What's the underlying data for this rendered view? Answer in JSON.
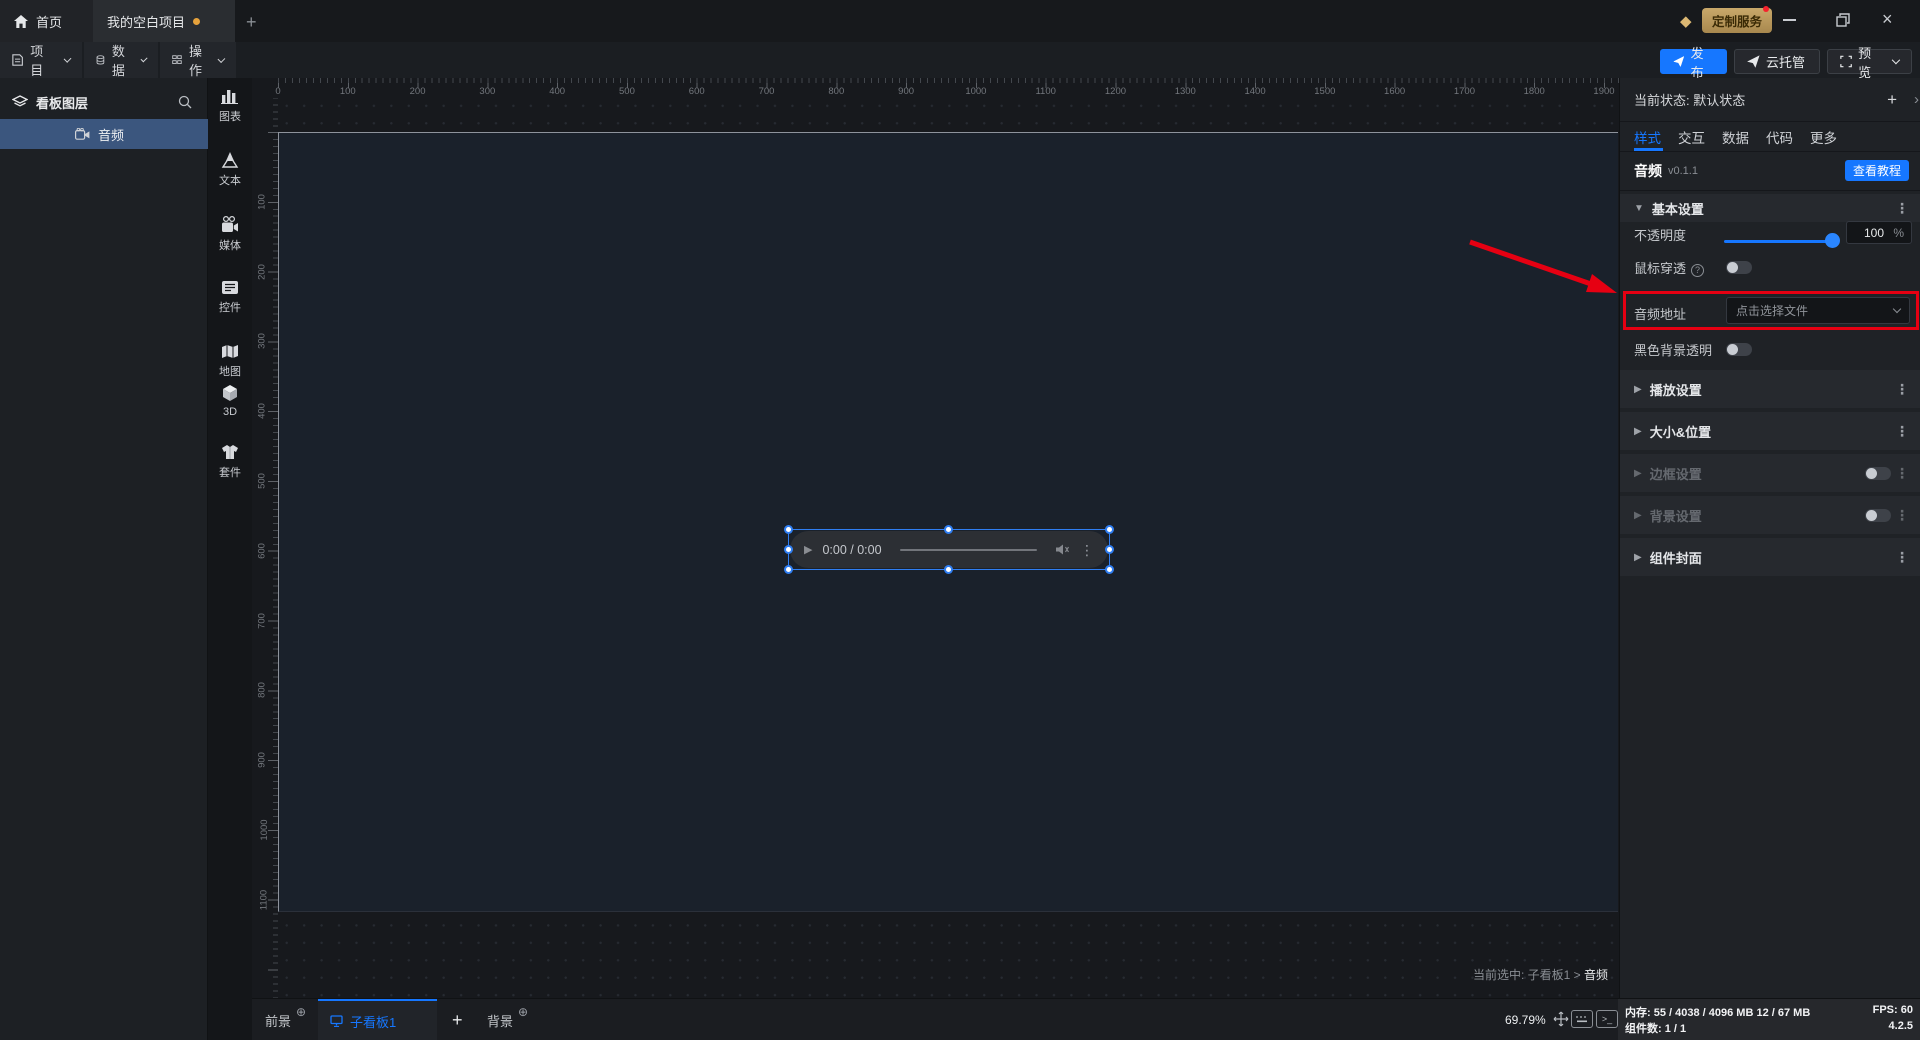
{
  "window": {
    "tabs": [
      {
        "label": "首页"
      },
      {
        "label": "我的空白项目"
      }
    ],
    "new_tab": "+",
    "vip": "定制服务",
    "close": "×"
  },
  "toolbar": {
    "menus": [
      "项目",
      "数据",
      "操作"
    ],
    "publish": "发布",
    "cloud": "云托管",
    "preview": "预览"
  },
  "layers": {
    "title": "看板图层",
    "item": "音频"
  },
  "assets": {
    "items": [
      "图表",
      "文本",
      "媒体",
      "控件",
      "地图",
      "3D",
      "套件"
    ]
  },
  "canvas": {
    "h_ruler": [
      "0",
      "100",
      "200",
      "300",
      "400",
      "500",
      "600",
      "700",
      "800",
      "900",
      "1000",
      "1100",
      "1200",
      "1300",
      "1400",
      "1500",
      "1600",
      "1700",
      "1800",
      "1900"
    ],
    "v_ruler": [
      "100",
      "200",
      "300",
      "400",
      "500",
      "600",
      "700",
      "800",
      "900",
      "1000",
      "1100"
    ],
    "player_time": "0:00 / 0:00",
    "status_prefix": "当前选中: 子看板1 >",
    "status_current": "音频"
  },
  "inspector": {
    "state_label": "当前状态:",
    "state_value": "默认状态",
    "add": "+",
    "tabs": [
      "样式",
      "交互",
      "数据",
      "代码",
      "更多"
    ],
    "comp_name": "音频",
    "comp_version": "v0.1.1",
    "tutorial": "查看教程",
    "basic_title": "基本设置",
    "opacity_label": "不透明度",
    "opacity_value": "100",
    "opacity_unit": "%",
    "mouse_label": "鼠标穿透",
    "audio_label": "音频地址",
    "audio_placeholder": "点击选择文件",
    "black_label": "黑色背景透明",
    "sections": [
      {
        "label": "播放设置"
      },
      {
        "label": "大小&位置"
      },
      {
        "label": "边框设置"
      },
      {
        "label": "背景设置"
      },
      {
        "label": "组件封面"
      }
    ]
  },
  "bottom": {
    "foreground": "前景",
    "board_tab": "子看板1",
    "add": "+",
    "background": "背景",
    "zoom": "69.79%",
    "memory_label": "内存:",
    "memory_value": "55 / 4038 / 4096 MB 12 / 67 MB",
    "fps_label": "FPS:",
    "fps_value": "60",
    "comp_label": "组件数:",
    "comp_value": "1 / 1",
    "version": "4.2.5"
  },
  "colors": {
    "accent": "#1677ff",
    "annotation": "#e60012",
    "layer_selected": "#3b567e",
    "board_bg": "#1a212b",
    "vip_gold": "#c9a86a"
  }
}
